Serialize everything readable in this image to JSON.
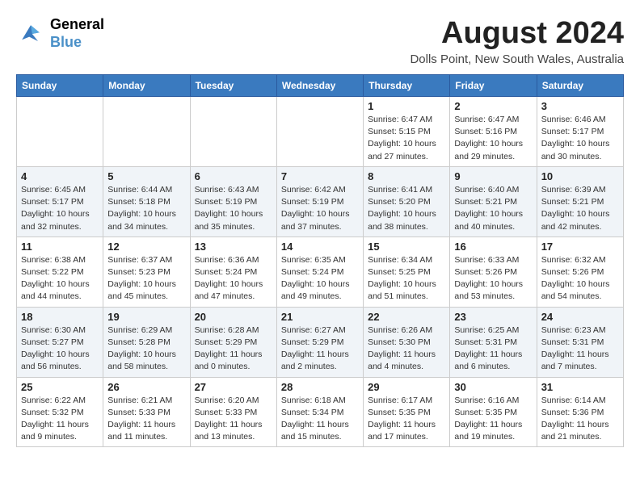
{
  "header": {
    "logo": {
      "general": "General",
      "blue": "Blue"
    },
    "title": "August 2024",
    "location": "Dolls Point, New South Wales, Australia"
  },
  "days_of_week": [
    "Sunday",
    "Monday",
    "Tuesday",
    "Wednesday",
    "Thursday",
    "Friday",
    "Saturday"
  ],
  "weeks": [
    [
      {
        "day": "",
        "info": ""
      },
      {
        "day": "",
        "info": ""
      },
      {
        "day": "",
        "info": ""
      },
      {
        "day": "",
        "info": ""
      },
      {
        "day": "1",
        "info": "Sunrise: 6:47 AM\nSunset: 5:15 PM\nDaylight: 10 hours\nand 27 minutes."
      },
      {
        "day": "2",
        "info": "Sunrise: 6:47 AM\nSunset: 5:16 PM\nDaylight: 10 hours\nand 29 minutes."
      },
      {
        "day": "3",
        "info": "Sunrise: 6:46 AM\nSunset: 5:17 PM\nDaylight: 10 hours\nand 30 minutes."
      }
    ],
    [
      {
        "day": "4",
        "info": "Sunrise: 6:45 AM\nSunset: 5:17 PM\nDaylight: 10 hours\nand 32 minutes."
      },
      {
        "day": "5",
        "info": "Sunrise: 6:44 AM\nSunset: 5:18 PM\nDaylight: 10 hours\nand 34 minutes."
      },
      {
        "day": "6",
        "info": "Sunrise: 6:43 AM\nSunset: 5:19 PM\nDaylight: 10 hours\nand 35 minutes."
      },
      {
        "day": "7",
        "info": "Sunrise: 6:42 AM\nSunset: 5:19 PM\nDaylight: 10 hours\nand 37 minutes."
      },
      {
        "day": "8",
        "info": "Sunrise: 6:41 AM\nSunset: 5:20 PM\nDaylight: 10 hours\nand 38 minutes."
      },
      {
        "day": "9",
        "info": "Sunrise: 6:40 AM\nSunset: 5:21 PM\nDaylight: 10 hours\nand 40 minutes."
      },
      {
        "day": "10",
        "info": "Sunrise: 6:39 AM\nSunset: 5:21 PM\nDaylight: 10 hours\nand 42 minutes."
      }
    ],
    [
      {
        "day": "11",
        "info": "Sunrise: 6:38 AM\nSunset: 5:22 PM\nDaylight: 10 hours\nand 44 minutes."
      },
      {
        "day": "12",
        "info": "Sunrise: 6:37 AM\nSunset: 5:23 PM\nDaylight: 10 hours\nand 45 minutes."
      },
      {
        "day": "13",
        "info": "Sunrise: 6:36 AM\nSunset: 5:24 PM\nDaylight: 10 hours\nand 47 minutes."
      },
      {
        "day": "14",
        "info": "Sunrise: 6:35 AM\nSunset: 5:24 PM\nDaylight: 10 hours\nand 49 minutes."
      },
      {
        "day": "15",
        "info": "Sunrise: 6:34 AM\nSunset: 5:25 PM\nDaylight: 10 hours\nand 51 minutes."
      },
      {
        "day": "16",
        "info": "Sunrise: 6:33 AM\nSunset: 5:26 PM\nDaylight: 10 hours\nand 53 minutes."
      },
      {
        "day": "17",
        "info": "Sunrise: 6:32 AM\nSunset: 5:26 PM\nDaylight: 10 hours\nand 54 minutes."
      }
    ],
    [
      {
        "day": "18",
        "info": "Sunrise: 6:30 AM\nSunset: 5:27 PM\nDaylight: 10 hours\nand 56 minutes."
      },
      {
        "day": "19",
        "info": "Sunrise: 6:29 AM\nSunset: 5:28 PM\nDaylight: 10 hours\nand 58 minutes."
      },
      {
        "day": "20",
        "info": "Sunrise: 6:28 AM\nSunset: 5:29 PM\nDaylight: 11 hours\nand 0 minutes."
      },
      {
        "day": "21",
        "info": "Sunrise: 6:27 AM\nSunset: 5:29 PM\nDaylight: 11 hours\nand 2 minutes."
      },
      {
        "day": "22",
        "info": "Sunrise: 6:26 AM\nSunset: 5:30 PM\nDaylight: 11 hours\nand 4 minutes."
      },
      {
        "day": "23",
        "info": "Sunrise: 6:25 AM\nSunset: 5:31 PM\nDaylight: 11 hours\nand 6 minutes."
      },
      {
        "day": "24",
        "info": "Sunrise: 6:23 AM\nSunset: 5:31 PM\nDaylight: 11 hours\nand 7 minutes."
      }
    ],
    [
      {
        "day": "25",
        "info": "Sunrise: 6:22 AM\nSunset: 5:32 PM\nDaylight: 11 hours\nand 9 minutes."
      },
      {
        "day": "26",
        "info": "Sunrise: 6:21 AM\nSunset: 5:33 PM\nDaylight: 11 hours\nand 11 minutes."
      },
      {
        "day": "27",
        "info": "Sunrise: 6:20 AM\nSunset: 5:33 PM\nDaylight: 11 hours\nand 13 minutes."
      },
      {
        "day": "28",
        "info": "Sunrise: 6:18 AM\nSunset: 5:34 PM\nDaylight: 11 hours\nand 15 minutes."
      },
      {
        "day": "29",
        "info": "Sunrise: 6:17 AM\nSunset: 5:35 PM\nDaylight: 11 hours\nand 17 minutes."
      },
      {
        "day": "30",
        "info": "Sunrise: 6:16 AM\nSunset: 5:35 PM\nDaylight: 11 hours\nand 19 minutes."
      },
      {
        "day": "31",
        "info": "Sunrise: 6:14 AM\nSunset: 5:36 PM\nDaylight: 11 hours\nand 21 minutes."
      }
    ]
  ]
}
